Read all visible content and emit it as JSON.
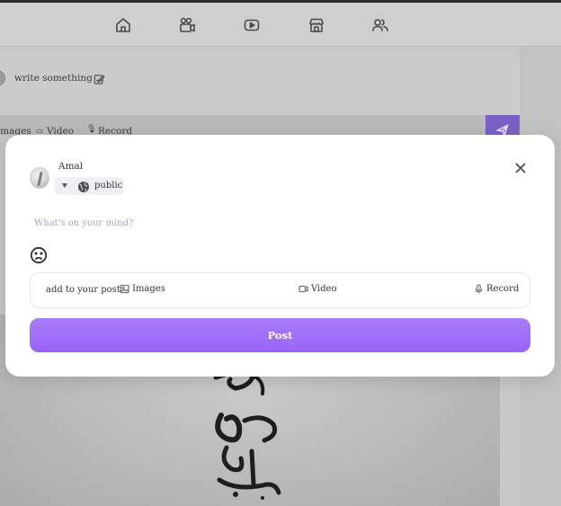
{
  "nav": {
    "icons": [
      "home-icon",
      "video-camera-icon",
      "play-icon",
      "store-icon",
      "users-icon"
    ]
  },
  "background_composer": {
    "placeholder": "write something ...",
    "actions": {
      "images": "Images",
      "video": "Video",
      "record": "Record"
    }
  },
  "modal": {
    "user_name": "Amal",
    "privacy": "public",
    "input_placeholder": "What's on your mind?",
    "add_to_post": "add to your post",
    "options": {
      "images": "Images",
      "video": "Video",
      "record": "Record"
    },
    "post_button": "Post"
  },
  "colors": {
    "accent": "#9f6ef8",
    "overlay": "#c8c8c8",
    "modal_bg": "#ffffff"
  }
}
